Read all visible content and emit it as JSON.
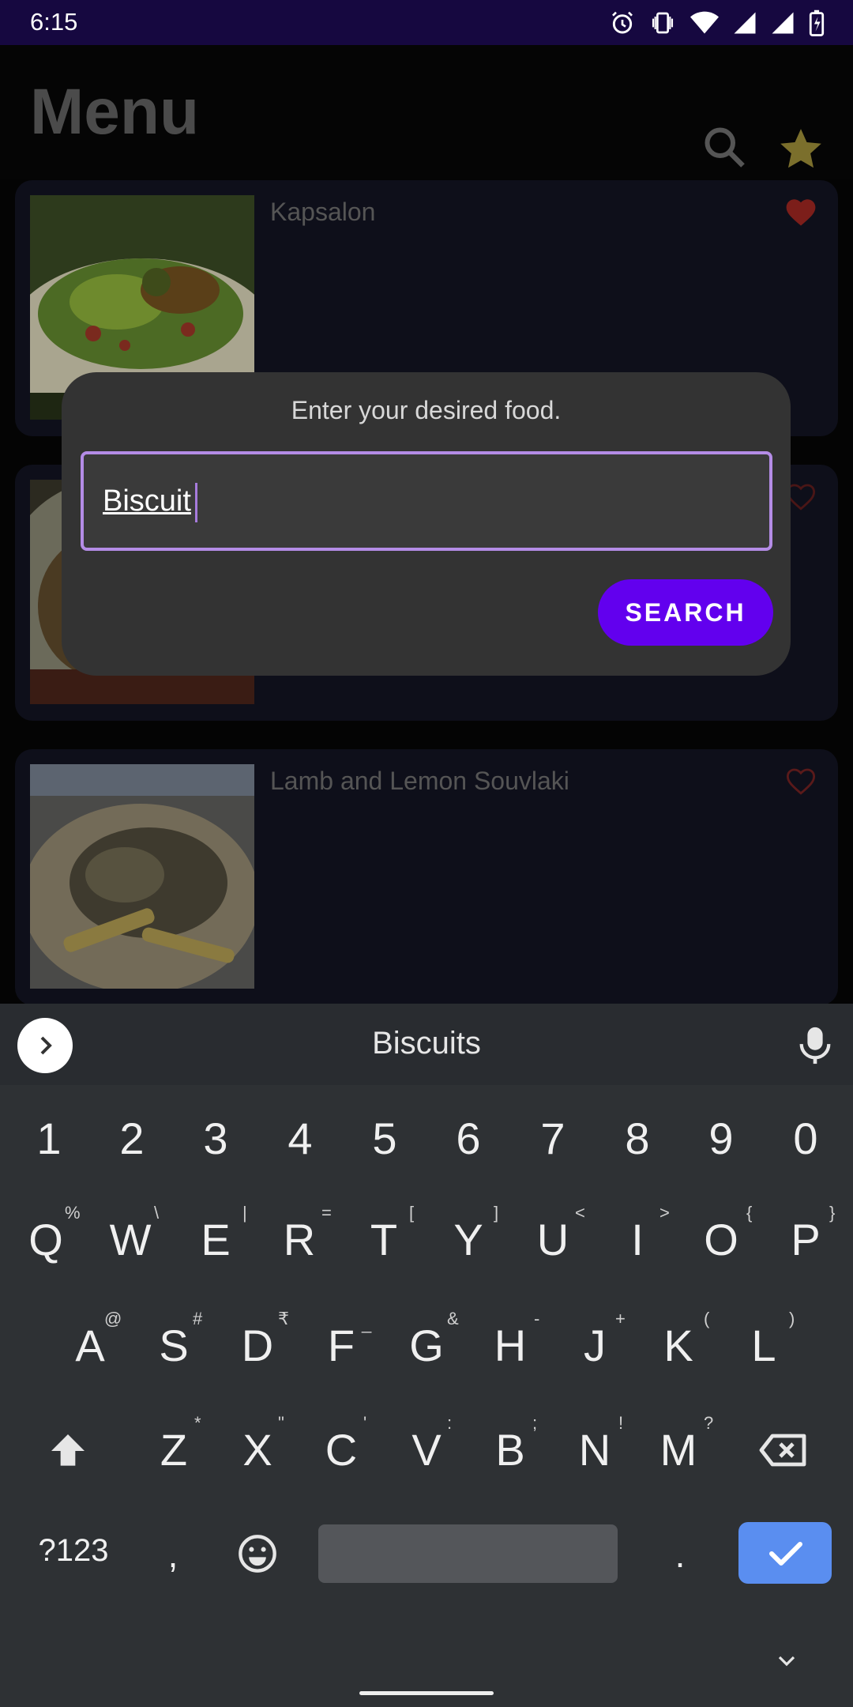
{
  "status_bar": {
    "time": "6:15"
  },
  "app_bar": {
    "title": "Menu"
  },
  "cards": [
    {
      "name": "Kapsalon",
      "favorite": true
    },
    {
      "name": "",
      "favorite": false
    },
    {
      "name": "Lamb and Lemon Souvlaki",
      "favorite": false
    }
  ],
  "dialog": {
    "prompt": "Enter your desired food.",
    "input_value": "Biscuit",
    "button_label": "SEARCH"
  },
  "keyboard": {
    "suggestion": "Biscuits",
    "number_row": [
      "1",
      "2",
      "3",
      "4",
      "5",
      "6",
      "7",
      "8",
      "9",
      "0"
    ],
    "row1": [
      [
        "Q",
        "%"
      ],
      [
        "W",
        "\\"
      ],
      [
        "E",
        "|"
      ],
      [
        "R",
        "="
      ],
      [
        "T",
        "["
      ],
      [
        "Y",
        "]"
      ],
      [
        "U",
        "<"
      ],
      [
        "I",
        ">"
      ],
      [
        "O",
        "{"
      ],
      [
        "P",
        "}"
      ]
    ],
    "row2": [
      [
        "A",
        "@"
      ],
      [
        "S",
        "#"
      ],
      [
        "D",
        "₹"
      ],
      [
        "F",
        "_"
      ],
      [
        "G",
        "&"
      ],
      [
        "H",
        "-"
      ],
      [
        "J",
        "+"
      ],
      [
        "K",
        "("
      ],
      [
        "L",
        ")"
      ]
    ],
    "row3": [
      [
        "Z",
        "*"
      ],
      [
        "X",
        "\""
      ],
      [
        "C",
        "'"
      ],
      [
        "V",
        ":"
      ],
      [
        "B",
        ";"
      ],
      [
        "N",
        "!"
      ],
      [
        "M",
        "?"
      ]
    ],
    "symbols_label": "?123",
    "comma": ",",
    "period": "."
  },
  "colors": {
    "accent": "#6200ee",
    "field_border": "#b48ce6",
    "heart_red": "#b3261e",
    "enter_key": "#5a8ef0"
  }
}
